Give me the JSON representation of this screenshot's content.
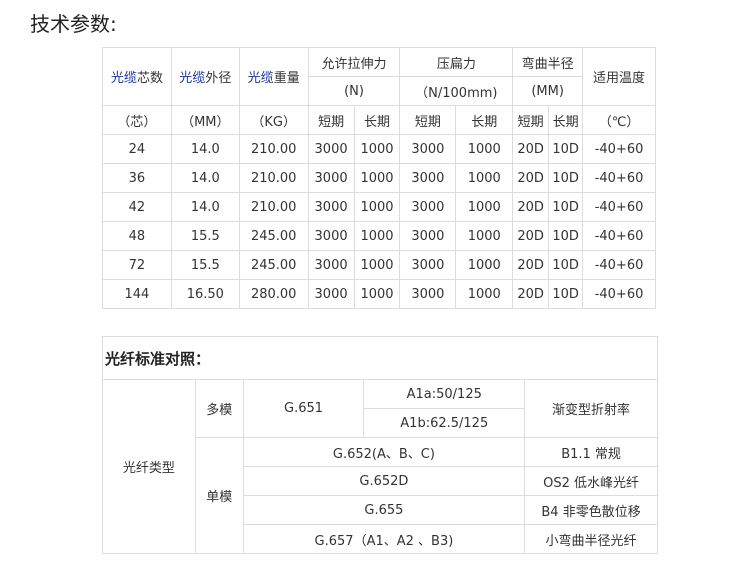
{
  "title": "技术参数:",
  "spec_table": {
    "headers": {
      "core_count": {
        "prefix": "光缆",
        "suffix": "芯数"
      },
      "outer_diameter": {
        "prefix": "光缆",
        "suffix": "外径"
      },
      "weight": {
        "prefix": "光缆",
        "suffix": "重量"
      },
      "tensile": {
        "label": "允许拉伸力",
        "unit": "(N)"
      },
      "crush": {
        "label": "压扁力",
        "unit": "（N/100mm)"
      },
      "bend": {
        "label": "弯曲半径",
        "unit": "(MM)"
      },
      "temp": {
        "label": "适用温度"
      }
    },
    "units": [
      "（芯）",
      "（MM）",
      "（KG）",
      "短期",
      "长期",
      "短期",
      "长期",
      "短期",
      "长期",
      "（℃）"
    ],
    "rows": [
      [
        "24",
        "14.0",
        "210.00",
        "3000",
        "1000",
        "3000",
        "1000",
        "20D",
        "10D",
        "-40+60"
      ],
      [
        "36",
        "14.0",
        "210.00",
        "3000",
        "1000",
        "3000",
        "1000",
        "20D",
        "10D",
        "-40+60"
      ],
      [
        "42",
        "14.0",
        "210.00",
        "3000",
        "1000",
        "3000",
        "1000",
        "20D",
        "10D",
        "-40+60"
      ],
      [
        "48",
        "15.5",
        "245.00",
        "3000",
        "1000",
        "3000",
        "1000",
        "20D",
        "10D",
        "-40+60"
      ],
      [
        "72",
        "15.5",
        "245.00",
        "3000",
        "1000",
        "3000",
        "1000",
        "20D",
        "10D",
        "-40+60"
      ],
      [
        "144",
        "16.50",
        "280.00",
        "3000",
        "1000",
        "3000",
        "1000",
        "20D",
        "10D",
        "-40+60"
      ]
    ]
  },
  "fiber_table": {
    "title": "光纤标准对照：",
    "fiber_type": "光纤类型",
    "multimode": {
      "label": "多模",
      "standard": "G.651",
      "subtypes": [
        "A1a:50/125",
        "A1b:62.5/125"
      ],
      "description": "渐变型折射率"
    },
    "singlemode": {
      "label": "单模",
      "rows": [
        {
          "standard": "G.652(A、B、C)",
          "description": "B1.1 常规"
        },
        {
          "standard": "G.652D",
          "description": "OS2  低水峰光纤"
        },
        {
          "standard": "G.655",
          "description": "B4 非零色散位移"
        },
        {
          "standard": "G.657（A1、A2 、B3)",
          "description": "小弯曲半径光纤"
        }
      ]
    }
  }
}
